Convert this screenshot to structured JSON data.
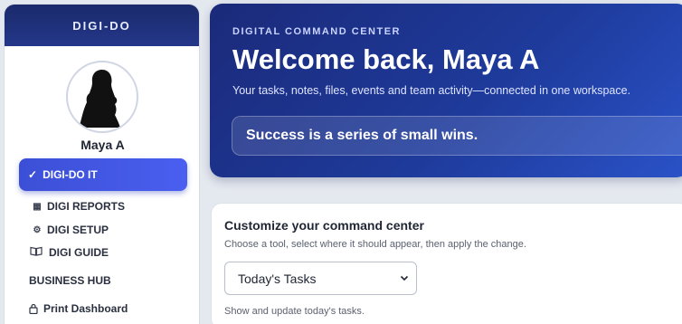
{
  "sidebar": {
    "brand": "DIGI-DO",
    "user_name": "Maya A",
    "active_item": {
      "icon": "check-icon",
      "glyph": "✓",
      "label": "DIGI-DO IT"
    },
    "items": [
      {
        "icon": "grid-icon",
        "glyph": "▦",
        "label": "DIGI REPORTS"
      },
      {
        "icon": "gear-icon",
        "glyph": "⚙",
        "label": "DIGI SETUP"
      },
      {
        "icon": "book-icon",
        "glyph": "📖",
        "label": "DIGI GUIDE"
      }
    ],
    "section_label": "BUSINESS HUB",
    "print_item": {
      "icon": "lock-icon",
      "label": "Print Dashboard"
    }
  },
  "hero": {
    "eyebrow": "DIGITAL COMMAND CENTER",
    "welcome": "Welcome back, Maya A",
    "subtitle": "Your tasks, notes, files, events and team activity—connected in one workspace.",
    "quote": "Success is a series of small wins."
  },
  "customize": {
    "title": "Customize your command center",
    "description": "Choose a tool, select where it should appear, then apply the change.",
    "select_value": "Today's Tasks",
    "helper": "Show and update today's tasks."
  },
  "colors": {
    "brand_dark": "#1a2a6b",
    "accent": "#3b4fd6",
    "hero_start": "#1b2a7a",
    "hero_end": "#2a52c8"
  }
}
